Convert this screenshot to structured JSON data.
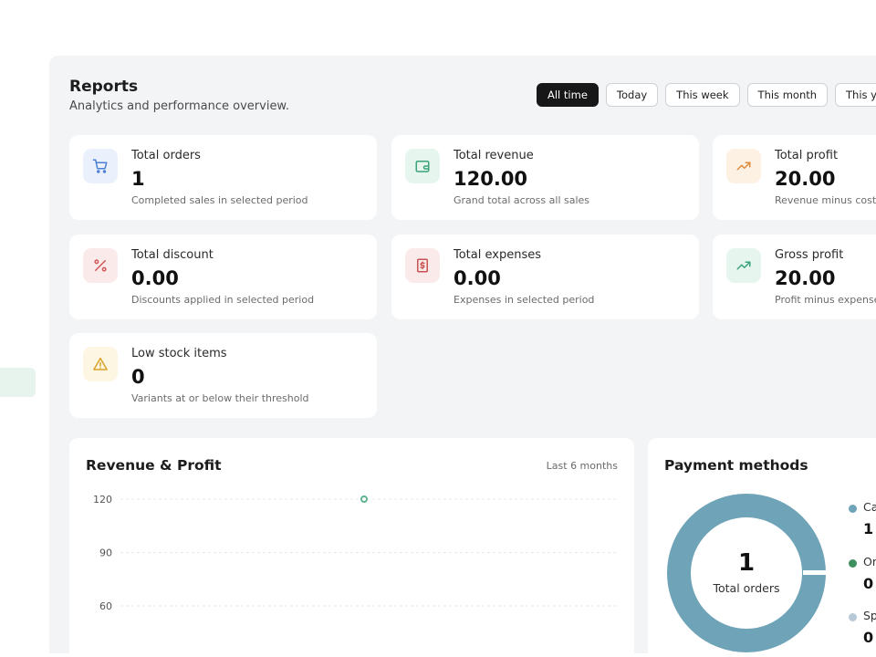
{
  "header": {
    "title": "Reports",
    "subtitle": "Analytics and performance overview."
  },
  "filters": [
    {
      "label": "All time",
      "active": true
    },
    {
      "label": "Today",
      "active": false
    },
    {
      "label": "This week",
      "active": false
    },
    {
      "label": "This month",
      "active": false
    },
    {
      "label": "This year",
      "active": false
    }
  ],
  "cards": [
    {
      "label": "Total orders",
      "value": "1",
      "desc": "Completed sales in selected period",
      "icon": "cart-icon",
      "color": "#4a7fd4",
      "bg": "#eaf1fc"
    },
    {
      "label": "Total revenue",
      "value": "120.00",
      "desc": "Grand total across all sales",
      "icon": "wallet-icon",
      "color": "#3aa37a",
      "bg": "#e6f6ef"
    },
    {
      "label": "Total profit",
      "value": "20.00",
      "desc": "Revenue minus cost",
      "icon": "trending-up-icon",
      "color": "#e08a3c",
      "bg": "#fdf1e4"
    },
    {
      "label": "Total discount",
      "value": "0.00",
      "desc": "Discounts applied in selected period",
      "icon": "percent-icon",
      "color": "#d45757",
      "bg": "#fbeaea"
    },
    {
      "label": "Total expenses",
      "value": "0.00",
      "desc": "Expenses in selected period",
      "icon": "receipt-icon",
      "color": "#c95353",
      "bg": "#fbeaea"
    },
    {
      "label": "Gross profit",
      "value": "20.00",
      "desc": "Profit minus expenses",
      "icon": "trending-up-icon",
      "color": "#3aa37a",
      "bg": "#e6f6ef"
    },
    {
      "label": "Low stock items",
      "value": "0",
      "desc": "Variants at or below their threshold",
      "icon": "warning-icon",
      "color": "#d9a22a",
      "bg": "#fdf6e3"
    }
  ],
  "revenue_panel": {
    "title": "Revenue & Profit",
    "note": "Last 6 months"
  },
  "chart_data": {
    "type": "line",
    "title": "Revenue & Profit",
    "yticks": [
      120,
      90,
      60
    ],
    "ylim": [
      0,
      120
    ],
    "series": [
      {
        "values": [
          120
        ],
        "color": "#5fb48f"
      }
    ],
    "grid": true
  },
  "payment_panel": {
    "title": "Payment methods",
    "center_value": "1",
    "center_label": "Total orders",
    "legend": [
      {
        "name": "Ca",
        "value": "1",
        "color": "#6fa4b8"
      },
      {
        "name": "On",
        "value": "0",
        "color": "#3f8f5f"
      },
      {
        "name": "Sp",
        "value": "0",
        "color": "#b7c9d6"
      }
    ],
    "ring_color": "#6fa4b8"
  }
}
